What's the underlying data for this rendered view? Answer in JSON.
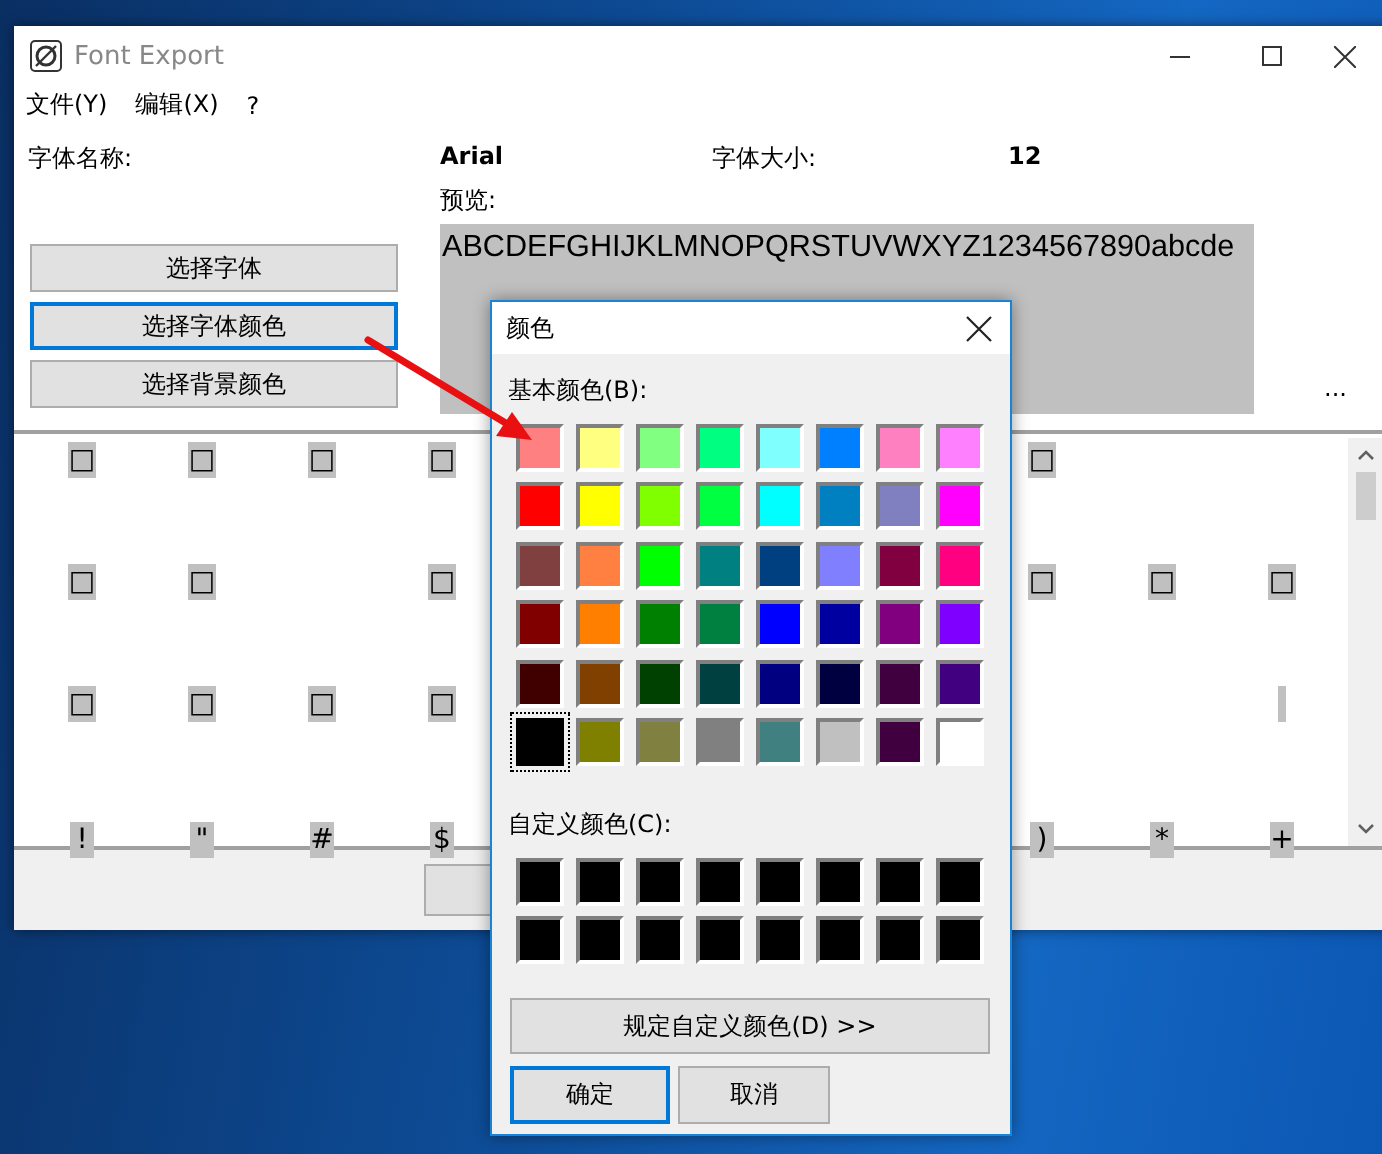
{
  "main_window": {
    "title": "Font Export",
    "menu": [
      "文件(Y)",
      "编辑(X)",
      "?"
    ],
    "font_name_label": "字体名称:",
    "font_name": "Arial",
    "font_size_label": "字体大小:",
    "font_size": "12",
    "preview_label": "预览:",
    "preview_text": "ABCDEFGHIJKLMNOPQRSTUVWXYZ1234567890abcde",
    "more": "...",
    "buttons": [
      {
        "label": "选择字体",
        "focused": false
      },
      {
        "label": "选择字体颜色",
        "focused": true
      },
      {
        "label": "选择背景颜色",
        "focused": false
      }
    ],
    "glyph_rows": [
      [
        {
          "kind": "glyph",
          "text": "□"
        },
        {
          "kind": "glyph",
          "text": "□"
        },
        {
          "kind": "glyph",
          "text": "□"
        },
        {
          "kind": "glyph",
          "text": "□"
        },
        {
          "kind": "empty"
        },
        {
          "kind": "empty"
        },
        {
          "kind": "empty"
        },
        {
          "kind": "empty"
        },
        {
          "kind": "glyph",
          "text": "□"
        },
        {
          "kind": "empty"
        },
        {
          "kind": "empty"
        }
      ],
      [
        {
          "kind": "glyph",
          "text": "□"
        },
        {
          "kind": "glyph",
          "text": "□"
        },
        {
          "kind": "empty"
        },
        {
          "kind": "glyph",
          "text": "□"
        },
        {
          "kind": "empty"
        },
        {
          "kind": "empty"
        },
        {
          "kind": "empty"
        },
        {
          "kind": "empty"
        },
        {
          "kind": "glyph",
          "text": "□"
        },
        {
          "kind": "glyph",
          "text": "□"
        },
        {
          "kind": "glyph",
          "text": "□"
        }
      ],
      [
        {
          "kind": "glyph",
          "text": "□"
        },
        {
          "kind": "glyph",
          "text": "□"
        },
        {
          "kind": "glyph",
          "text": "□"
        },
        {
          "kind": "glyph",
          "text": "□"
        },
        {
          "kind": "empty"
        },
        {
          "kind": "empty"
        },
        {
          "kind": "empty"
        },
        {
          "kind": "empty"
        },
        {
          "kind": "empty"
        },
        {
          "kind": "empty"
        },
        {
          "kind": "blank"
        }
      ],
      [
        {
          "kind": "glyph",
          "text": "!"
        },
        {
          "kind": "glyph",
          "text": "\""
        },
        {
          "kind": "glyph",
          "text": "#"
        },
        {
          "kind": "glyph",
          "text": "$"
        },
        {
          "kind": "empty"
        },
        {
          "kind": "empty"
        },
        {
          "kind": "empty"
        },
        {
          "kind": "empty"
        },
        {
          "kind": "glyph",
          "text": ")"
        },
        {
          "kind": "glyph",
          "text": "*"
        },
        {
          "kind": "glyph",
          "text": "+"
        }
      ]
    ]
  },
  "color_dialog": {
    "title": "颜色",
    "basic_colors_label": "基本颜色(B):",
    "basic_colors": [
      {
        "color": "#ff8080",
        "selected": false
      },
      {
        "color": "#ffff80",
        "selected": false
      },
      {
        "color": "#80ff80",
        "selected": false
      },
      {
        "color": "#00ff80",
        "selected": false
      },
      {
        "color": "#80ffff",
        "selected": false
      },
      {
        "color": "#0080ff",
        "selected": false
      },
      {
        "color": "#ff80c0",
        "selected": false
      },
      {
        "color": "#ff80ff",
        "selected": false
      },
      {
        "color": "#ff0000",
        "selected": false
      },
      {
        "color": "#ffff00",
        "selected": false
      },
      {
        "color": "#80ff00",
        "selected": false
      },
      {
        "color": "#00ff40",
        "selected": false
      },
      {
        "color": "#00ffff",
        "selected": false
      },
      {
        "color": "#0080c0",
        "selected": false
      },
      {
        "color": "#8080c0",
        "selected": false
      },
      {
        "color": "#ff00ff",
        "selected": false
      },
      {
        "color": "#804040",
        "selected": false
      },
      {
        "color": "#ff8040",
        "selected": false
      },
      {
        "color": "#00ff00",
        "selected": false
      },
      {
        "color": "#008080",
        "selected": false
      },
      {
        "color": "#004080",
        "selected": false
      },
      {
        "color": "#8080ff",
        "selected": false
      },
      {
        "color": "#800040",
        "selected": false
      },
      {
        "color": "#ff0080",
        "selected": false
      },
      {
        "color": "#800000",
        "selected": false
      },
      {
        "color": "#ff8000",
        "selected": false
      },
      {
        "color": "#008000",
        "selected": false
      },
      {
        "color": "#008040",
        "selected": false
      },
      {
        "color": "#0000ff",
        "selected": false
      },
      {
        "color": "#0000a0",
        "selected": false
      },
      {
        "color": "#800080",
        "selected": false
      },
      {
        "color": "#8000ff",
        "selected": false
      },
      {
        "color": "#400000",
        "selected": false
      },
      {
        "color": "#804000",
        "selected": false
      },
      {
        "color": "#004000",
        "selected": false
      },
      {
        "color": "#004040",
        "selected": false
      },
      {
        "color": "#000080",
        "selected": false
      },
      {
        "color": "#000040",
        "selected": false
      },
      {
        "color": "#400040",
        "selected": false
      },
      {
        "color": "#400080",
        "selected": false
      },
      {
        "color": "#000000",
        "selected": true
      },
      {
        "color": "#808000",
        "selected": false
      },
      {
        "color": "#808040",
        "selected": false
      },
      {
        "color": "#808080",
        "selected": false
      },
      {
        "color": "#408080",
        "selected": false
      },
      {
        "color": "#c0c0c0",
        "selected": false
      },
      {
        "color": "#400040",
        "selected": false
      },
      {
        "color": "#ffffff",
        "selected": false
      }
    ],
    "custom_colors_label": "自定义颜色(C):",
    "custom_colors": [
      {
        "color": "#000000"
      },
      {
        "color": "#000000"
      },
      {
        "color": "#000000"
      },
      {
        "color": "#000000"
      },
      {
        "color": "#000000"
      },
      {
        "color": "#000000"
      },
      {
        "color": "#000000"
      },
      {
        "color": "#000000"
      },
      {
        "color": "#000000"
      },
      {
        "color": "#000000"
      },
      {
        "color": "#000000"
      },
      {
        "color": "#000000"
      },
      {
        "color": "#000000"
      },
      {
        "color": "#000000"
      },
      {
        "color": "#000000"
      },
      {
        "color": "#000000"
      }
    ],
    "define_button": "规定自定义颜色(D) >>",
    "buttons": [
      {
        "label": "确定",
        "default": true
      },
      {
        "label": "取消",
        "default": false
      }
    ]
  }
}
